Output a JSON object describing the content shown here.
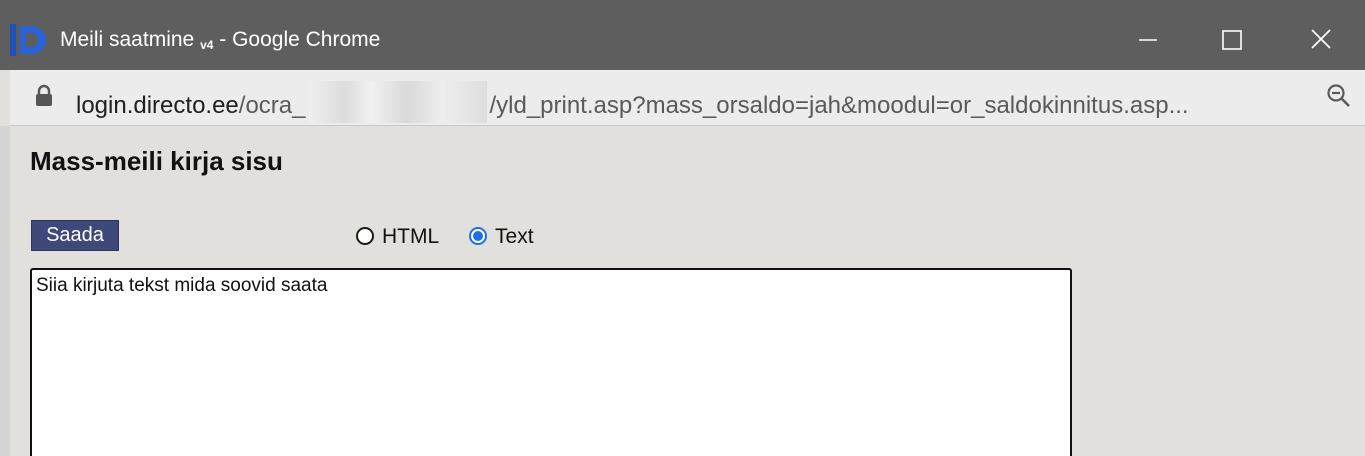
{
  "window": {
    "title": "Meili saatmine",
    "title_version": "v4",
    "title_suffix": " - Google Chrome",
    "icons": {
      "app": "directo-logo-icon",
      "minimize": "minimize-icon",
      "maximize": "maximize-icon",
      "close": "close-icon"
    }
  },
  "address_bar": {
    "url_host": "login.directo.ee",
    "url_path_start": "/ocra_",
    "url_path_rest": "/yld_print.asp?mass_orsaldo=jah&moodul=or_saldokinnitus.asp...",
    "icons": {
      "lock": "lock-icon",
      "zoom": "zoom-out-icon"
    }
  },
  "page": {
    "heading": "Mass-meili kirja sisu",
    "send_label": "Saada",
    "format_options": [
      {
        "label": "HTML",
        "selected": false
      },
      {
        "label": "Text",
        "selected": true
      }
    ],
    "message_text": "Siia kirjuta tekst mida soovid saata"
  },
  "colors": {
    "titlebar": "#5e5e5e",
    "button": "#3e4979",
    "radio_selected": "#1a6fe8",
    "page_background": "#e1e0dc"
  }
}
